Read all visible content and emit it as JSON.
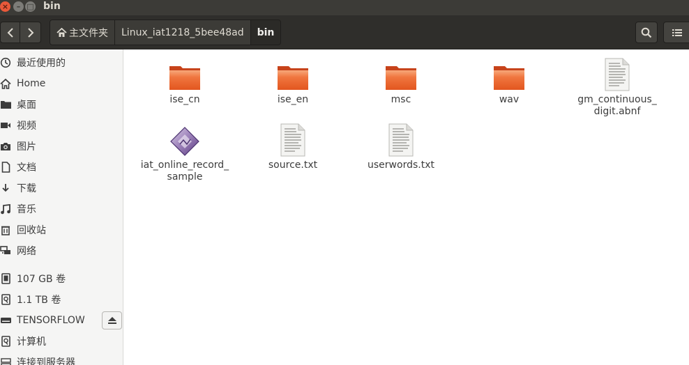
{
  "window": {
    "title": "bin",
    "close_glyph": "×",
    "min_glyph": "–",
    "max_glyph": "□"
  },
  "toolbar": {
    "back_icon": "chevron-left-icon",
    "forward_icon": "chevron-right-icon",
    "path": [
      "主文件夹",
      "Linux_iat1218_5bee48ad",
      "bin"
    ],
    "search_icon": "search-icon",
    "view_icon": "list-view-icon"
  },
  "sidebar": {
    "items": [
      {
        "label": "最近使用的",
        "icon": "recent-icon"
      },
      {
        "label": "Home",
        "icon": "home-icon"
      },
      {
        "label": "桌面",
        "icon": "desktop-folder-icon"
      },
      {
        "label": "视频",
        "icon": "video-icon"
      },
      {
        "label": "图片",
        "icon": "camera-icon"
      },
      {
        "label": "文档",
        "icon": "document-icon"
      },
      {
        "label": "下载",
        "icon": "download-icon"
      },
      {
        "label": "音乐",
        "icon": "music-icon"
      },
      {
        "label": "回收站",
        "icon": "trash-icon"
      },
      {
        "label": "网络",
        "icon": "network-icon"
      },
      {
        "label": "107 GB 卷",
        "icon": "drive-icon"
      },
      {
        "label": "1.1 TB 卷",
        "icon": "drive-icon"
      },
      {
        "label": "TENSORFLOW",
        "icon": "removable-drive-icon"
      },
      {
        "label": "计算机",
        "icon": "computer-drive-icon"
      },
      {
        "label": "连接到服务器",
        "icon": "server-icon"
      }
    ],
    "eject_icon": "eject-icon"
  },
  "files": [
    {
      "name": "ise_cn",
      "type": "folder",
      "icon": "folder-icon"
    },
    {
      "name": "ise_en",
      "type": "folder",
      "icon": "folder-icon"
    },
    {
      "name": "msc",
      "type": "folder",
      "icon": "folder-icon"
    },
    {
      "name": "wav",
      "type": "folder",
      "icon": "folder-icon"
    },
    {
      "name": "gm_continuous_\ndigit.abnf",
      "type": "text",
      "icon": "text-file-icon"
    },
    {
      "name": "iat_online_record_\nsample",
      "type": "executable",
      "icon": "executable-icon"
    },
    {
      "name": "source.txt",
      "type": "text",
      "icon": "text-file-icon"
    },
    {
      "name": "userwords.txt",
      "type": "text",
      "icon": "text-file-icon"
    }
  ],
  "colors": {
    "titlebar": "#3c3b37",
    "toolbar": "#2f2e2b",
    "folder_orange": "#e95420",
    "sidebar_bg": "#f5f5f4"
  }
}
